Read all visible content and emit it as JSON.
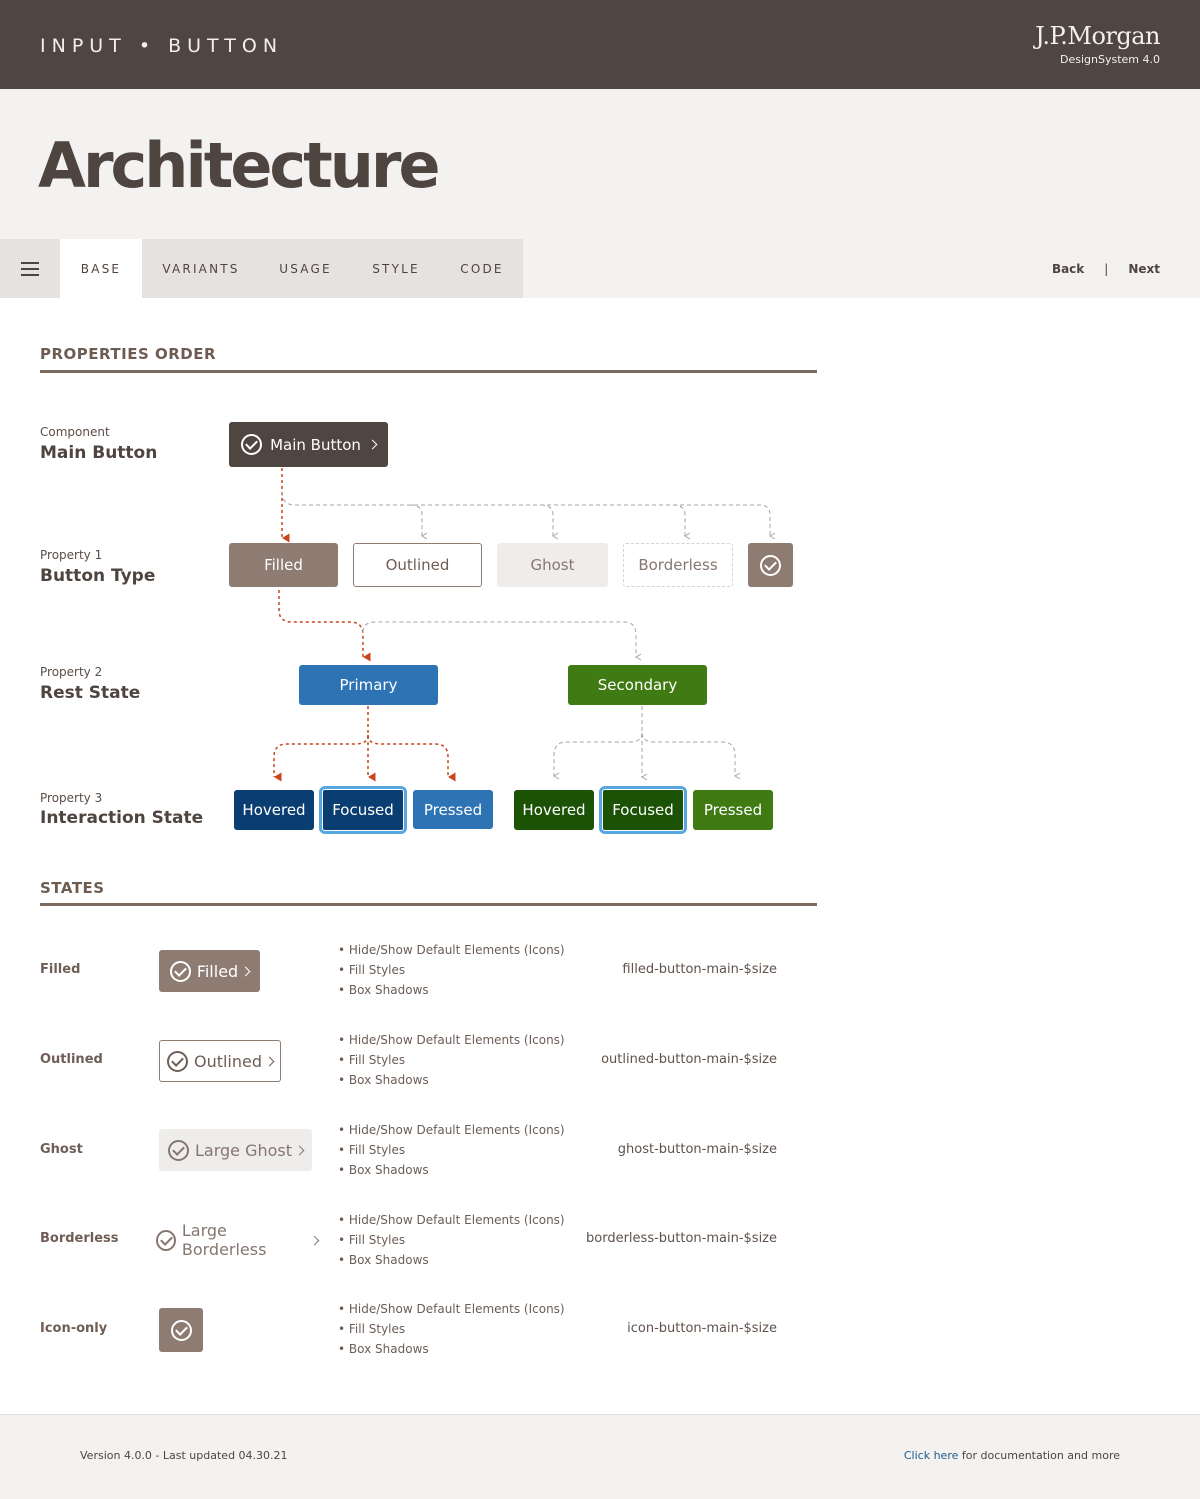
{
  "header": {
    "title": "INPUT • BUTTON",
    "brand": "J.P.Morgan",
    "brand_sub": "DesignSystem  4.0"
  },
  "page": {
    "title": "Architecture"
  },
  "tabs": [
    {
      "label": "BASE",
      "active": true
    },
    {
      "label": "VARIANTS",
      "active": false
    },
    {
      "label": "USAGE",
      "active": false
    },
    {
      "label": "STYLE",
      "active": false
    },
    {
      "label": "CODE",
      "active": false
    }
  ],
  "pager": {
    "back": "Back",
    "separator": "|",
    "next": "Next"
  },
  "icons": {
    "menu": "hamburger-icon",
    "check": "check-circle-icon",
    "chevron": "chevron-right-icon"
  },
  "properties": {
    "title": "PROPERTIES  ORDER",
    "component": {
      "small": "Component",
      "big": "Main Button",
      "button": "Main Button"
    },
    "property1": {
      "small": "Property 1",
      "big": "Button Type",
      "buttons": [
        "Filled",
        "Outlined",
        "Ghost",
        "Borderless"
      ]
    },
    "property2": {
      "small": "Property 2",
      "big": "Rest State",
      "buttons": [
        "Primary",
        "Secondary"
      ]
    },
    "property3": {
      "small": "Property 3",
      "big": "Interaction State",
      "buttons": [
        "Hovered",
        "Focused",
        "Pressed",
        "Hovered",
        "Focused",
        "Pressed"
      ]
    }
  },
  "states": {
    "title": "STATES",
    "rows": [
      {
        "name": "Filled",
        "button": "Filled",
        "bullets": [
          "Hide/Show Default Elements (Icons)",
          "Fill Styles",
          "Box Shadows"
        ],
        "token": "filled-button-main-$size"
      },
      {
        "name": "Outlined",
        "button": "Outlined",
        "bullets": [
          "Hide/Show Default Elements (Icons)",
          "Fill Styles",
          "Box Shadows"
        ],
        "token": "outlined-button-main-$size"
      },
      {
        "name": "Ghost",
        "button": "Large Ghost",
        "bullets": [
          "Hide/Show Default Elements (Icons)",
          "Fill Styles",
          "Box Shadows"
        ],
        "token": "ghost-button-main-$size"
      },
      {
        "name": "Borderless",
        "button": "Large Borderless",
        "bullets": [
          "Hide/Show Default Elements (Icons)",
          "Fill Styles",
          "Box Shadows"
        ],
        "token": "borderless-button-main-$size"
      },
      {
        "name": "Icon-only",
        "button": "",
        "bullets": [
          "Hide/Show Default Elements (Icons)",
          "Fill Styles",
          "Box Shadows"
        ],
        "token": "icon-button-main-$size"
      }
    ]
  },
  "colors": {
    "brown": "#4f4541",
    "taupe": "#8e7b72",
    "blue": "#2e74b5",
    "dark_blue": "#0a3e72",
    "green": "#3f7a12",
    "dark_green": "#1c5206",
    "connector_active": "#c9451d",
    "connector_inactive": "#a8a3a0"
  },
  "footer": {
    "version": "Version 4.0.0 - Last updated 04.30.21",
    "link": "Click here",
    "link_suffix": " for documentation and more"
  }
}
